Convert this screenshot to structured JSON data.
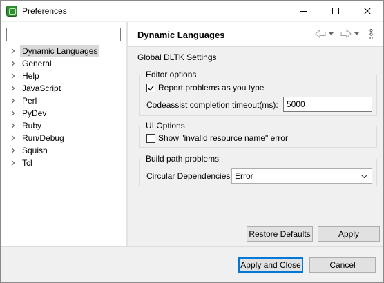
{
  "window": {
    "title": "Preferences"
  },
  "sidebar": {
    "filter_value": "",
    "items": [
      {
        "label": "Dynamic Languages",
        "selected": true
      },
      {
        "label": "General"
      },
      {
        "label": "Help"
      },
      {
        "label": "JavaScript"
      },
      {
        "label": "Perl"
      },
      {
        "label": "PyDev"
      },
      {
        "label": "Ruby"
      },
      {
        "label": "Run/Debug"
      },
      {
        "label": "Squish"
      },
      {
        "label": "Tcl"
      }
    ]
  },
  "page": {
    "title": "Dynamic Languages",
    "section_label": "Global DLTK Settings",
    "editor_options": {
      "title": "Editor options",
      "report_problems_label": "Report problems as you type",
      "report_problems_checked": true,
      "timeout_label": "Codeassist completion timeout(ms):",
      "timeout_value": "5000"
    },
    "ui_options": {
      "title": "UI Options",
      "invalid_name_label": "Show \"invalid resource name\" error",
      "invalid_name_checked": false
    },
    "build_path": {
      "title": "Build path problems",
      "circular_label": "Circular Dependencies",
      "circular_value": "Error"
    },
    "restore_defaults_label": "Restore Defaults",
    "apply_label": "Apply"
  },
  "footer": {
    "apply_close_label": "Apply and Close",
    "cancel_label": "Cancel"
  },
  "icons": {
    "app": "eclipse-app-icon",
    "back": "back-arrow-icon",
    "forward": "forward-arrow-icon",
    "menu": "view-menu-icon"
  }
}
